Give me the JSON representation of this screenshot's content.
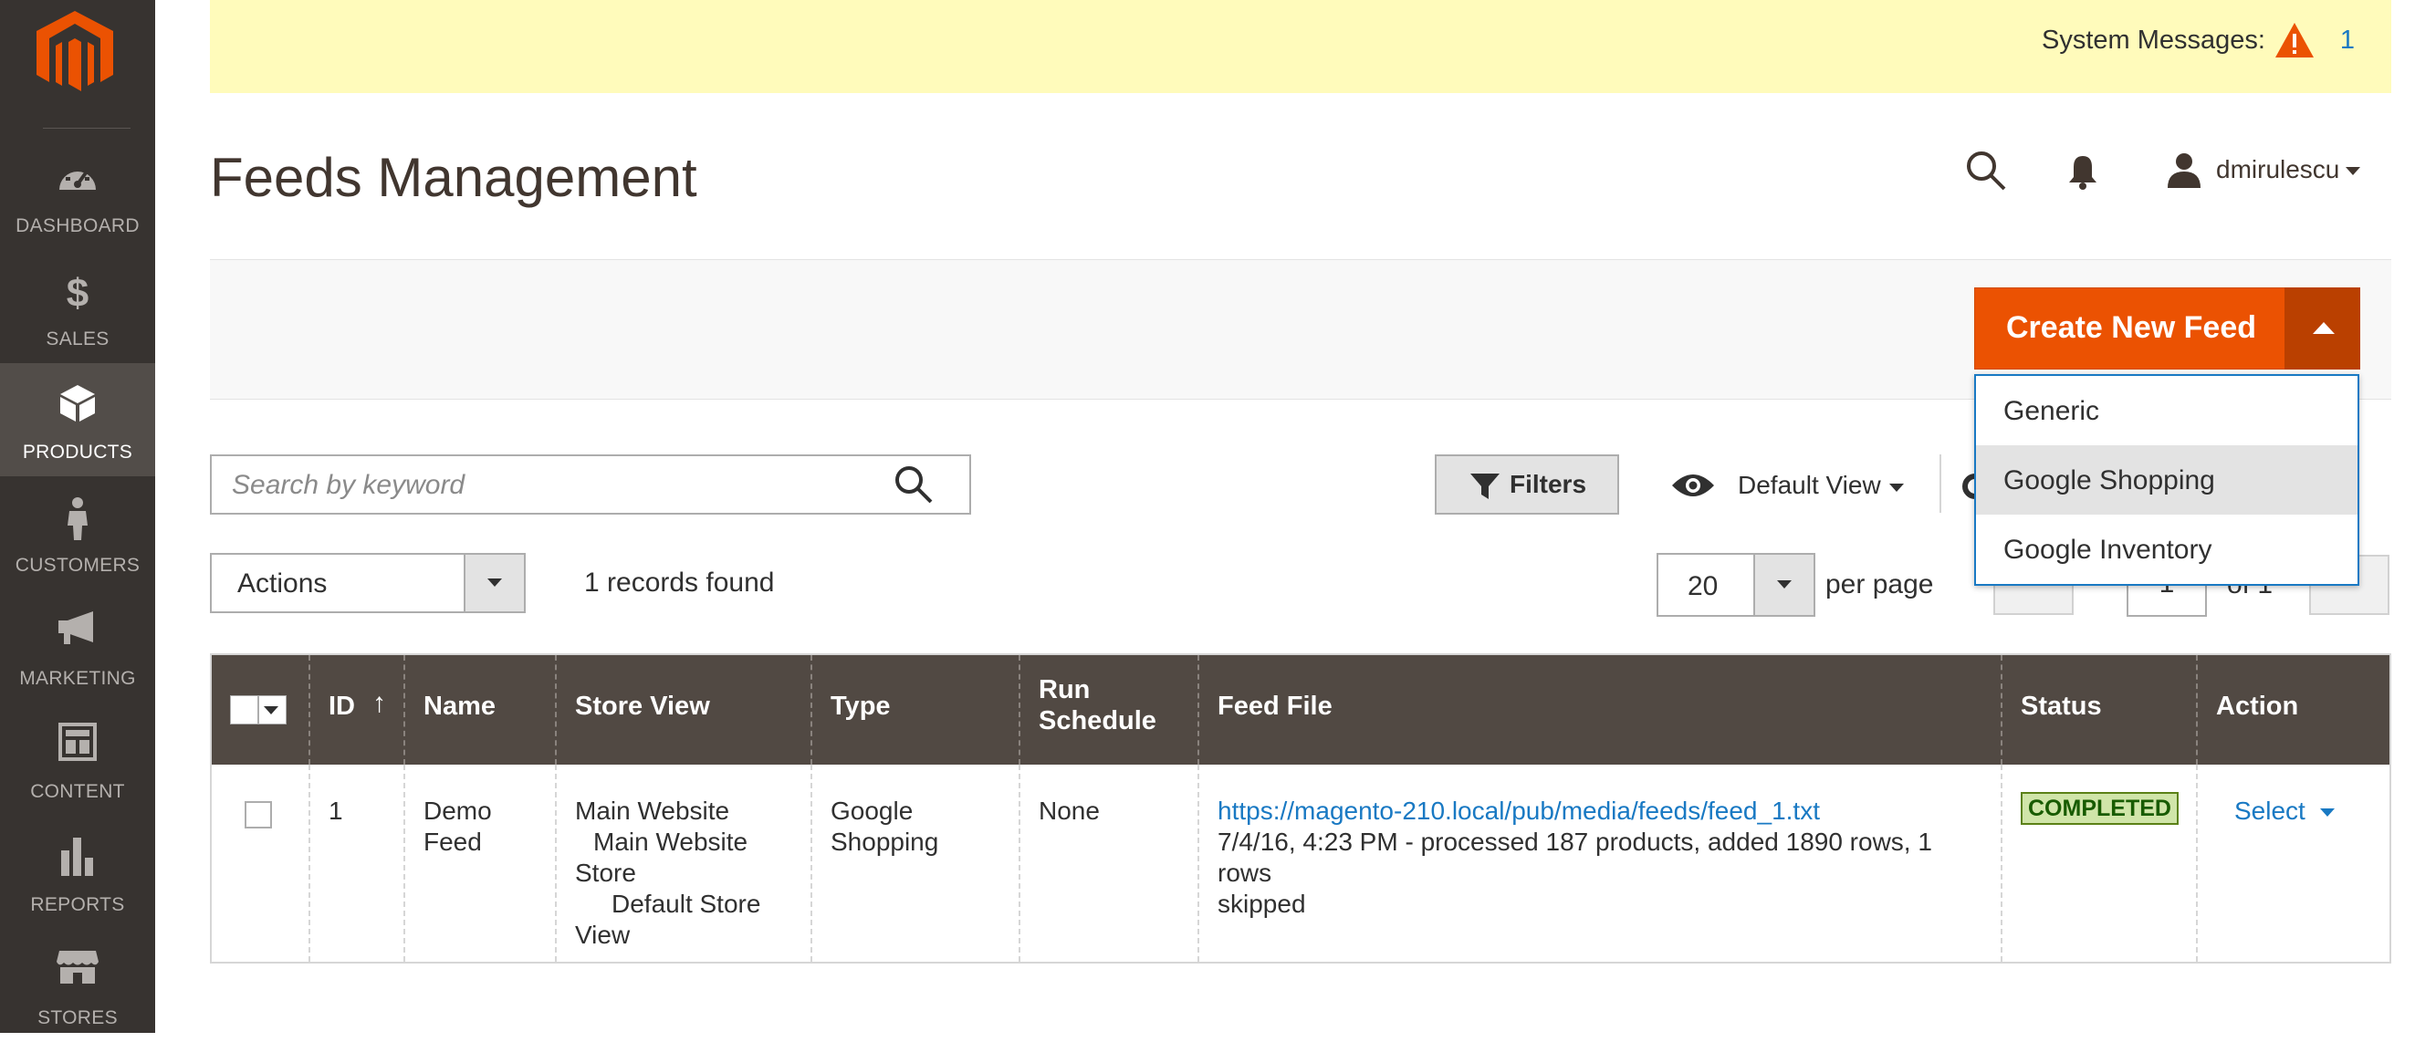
{
  "sidebar": {
    "items": [
      {
        "label": "DASHBOARD",
        "icon": "dashboard-icon"
      },
      {
        "label": "SALES",
        "icon": "dollar-icon"
      },
      {
        "label": "PRODUCTS",
        "icon": "box-icon",
        "active": true
      },
      {
        "label": "CUSTOMERS",
        "icon": "person-icon"
      },
      {
        "label": "MARKETING",
        "icon": "megaphone-icon"
      },
      {
        "label": "CONTENT",
        "icon": "layout-icon"
      },
      {
        "label": "REPORTS",
        "icon": "bar-chart-icon"
      },
      {
        "label": "STORES",
        "icon": "store-icon"
      }
    ]
  },
  "system": {
    "label": "System Messages:",
    "count": "1"
  },
  "header": {
    "title": "Feeds Management",
    "user": "dmirulescu"
  },
  "create": {
    "label": "Create New Feed",
    "options": [
      "Generic",
      "Google Shopping",
      "Google Inventory"
    ],
    "hovered": "Google Shopping"
  },
  "toolbar": {
    "search_placeholder": "Search by keyword",
    "filters_label": "Filters",
    "view_label": "Default View",
    "actions_label": "Actions",
    "records": "1 records found",
    "per_page_value": "20",
    "per_page_label": "per page",
    "page_value": "1",
    "page_of": "of 1"
  },
  "table": {
    "columns": {
      "id": "ID",
      "id_sort": "↑",
      "name": "Name",
      "store_view": "Store View",
      "type": "Type",
      "run_schedule_1": "Run",
      "run_schedule_2": "Schedule",
      "feed_file": "Feed File",
      "status": "Status",
      "action": "Action"
    },
    "rows": [
      {
        "id": "1",
        "name_1": "Demo",
        "name_2": "Feed",
        "store_1": "Main Website",
        "store_2": "Main Website",
        "store_3": "Store",
        "store_4": "Default Store",
        "store_5": "View",
        "type_1": "Google",
        "type_2": "Shopping",
        "schedule": "None",
        "feed_url": "https://magento-210.local/pub/media/feeds/feed_1.txt",
        "feed_note_1": "7/4/16, 4:23 PM - processed 187 products, added 1890 rows, 1 rows",
        "feed_note_2": "skipped",
        "status": "COMPLETED",
        "action": "Select"
      }
    ]
  },
  "colors": {
    "accent": "#eb5202",
    "sidebar": "#373330",
    "link": "#1979c3",
    "header_row": "#514943"
  }
}
